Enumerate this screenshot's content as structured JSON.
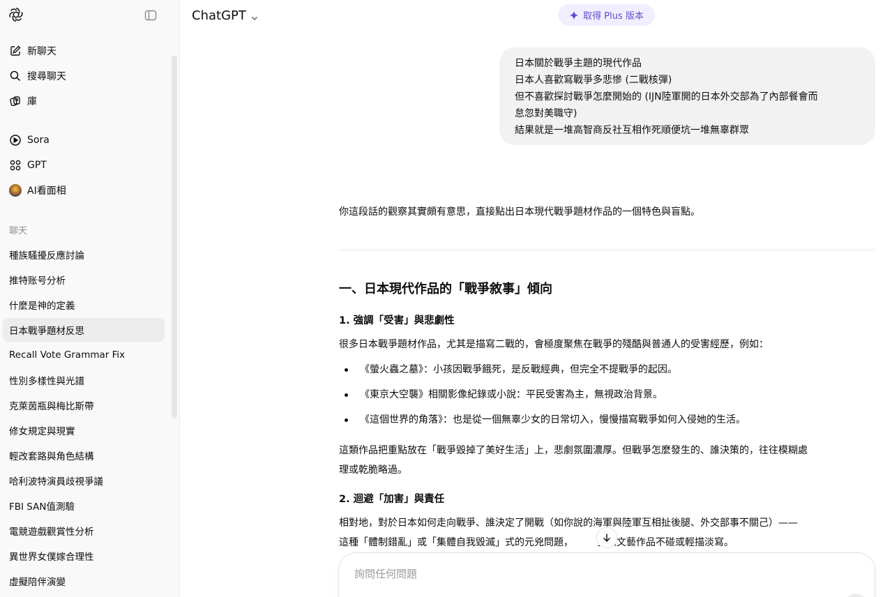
{
  "sidebar": {
    "nav": [
      {
        "label": "新聊天",
        "icon": "new-chat-icon"
      },
      {
        "label": "搜尋聊天",
        "icon": "search-icon"
      },
      {
        "label": "庫",
        "icon": "library-icon"
      }
    ],
    "apps": [
      {
        "label": "Sora",
        "icon": "play-circle-icon"
      },
      {
        "label": "GPT",
        "icon": "grid-icon"
      },
      {
        "label": "AI看面相",
        "icon": "avatar-icon"
      }
    ],
    "section_label": "聊天",
    "chats": [
      "種族騷擾反應討論",
      "推特账号分析",
      "什麼是神的定義",
      "日本戰爭題材反思",
      "Recall Vote Grammar Fix",
      "性別多樣性與光譜",
      "克萊茵瓶與梅比斯帶",
      "修女規定與現實",
      "輕改套路與角色結構",
      "哈利波特演員歧視爭議",
      "FBI SAN值測驗",
      "電競遊戲觀賞性分析",
      "異世界女僕嫁合理性",
      "虛擬陪伴演變"
    ],
    "active_chat_index": 3
  },
  "header": {
    "model": "ChatGPT",
    "plus_label": "取得 Plus 版本"
  },
  "user_message": [
    "日本關於戰爭主題的現代作品",
    "日本人喜歡寫戰爭多悲慘 (二戰核彈)",
    "但不喜歡探討戰爭怎麼開始的 (IJN陸軍開的日本外交部為了內部餐會而",
    "怠忽對美職守)",
    "結果就是一堆高智商反社互相作死順便坑一堆無辜群眾"
  ],
  "assistant": {
    "intro": "你這段話的觀察其實頗有意思，直接點出日本現代戰爭題材作品的一個特色與盲點。",
    "h2": "一、日本現代作品的「戰爭敘事」傾向",
    "h3_1": "1. 強調「受害」與悲劇性",
    "p1": "很多日本戰爭題材作品，尤其是描寫二戰的，會極度聚焦在戰爭的殘酷與普通人的受害經歷，例如：",
    "bullets": [
      "《螢火蟲之墓》：小孩因戰爭餓死，是反戰經典，但完全不提戰爭的起因。",
      "《東京大空襲》相關影像紀錄或小說：平民受害為主，無視政治背景。",
      "《這個世界的角落》：也是從一個無辜少女的日常切入，慢慢描寫戰爭如何入侵她的生活。"
    ],
    "p2_line1": "這類作品把重點放在「戰爭毀掉了美好生活」上，悲劇氛圍濃厚。但戰爭怎麼發生的、誰決策的，往往模糊處",
    "p2_line2": "理或乾脆略過。",
    "h3_2": "2. 迴避「加害」與責任",
    "p3_line1": "相對地，對於日本如何走向戰爭、誰決定了開戰（如你說的海軍與陸軍互相扯後腿、外交部事不關己）——",
    "p3_line2_a": "這種「體制錯亂」或「集體自我毀滅」式的元兇問題，",
    "p3_line2_b": "多數文藝作品不碰或輕描淡寫。"
  },
  "composer": {
    "placeholder": "詢問任何問題"
  }
}
